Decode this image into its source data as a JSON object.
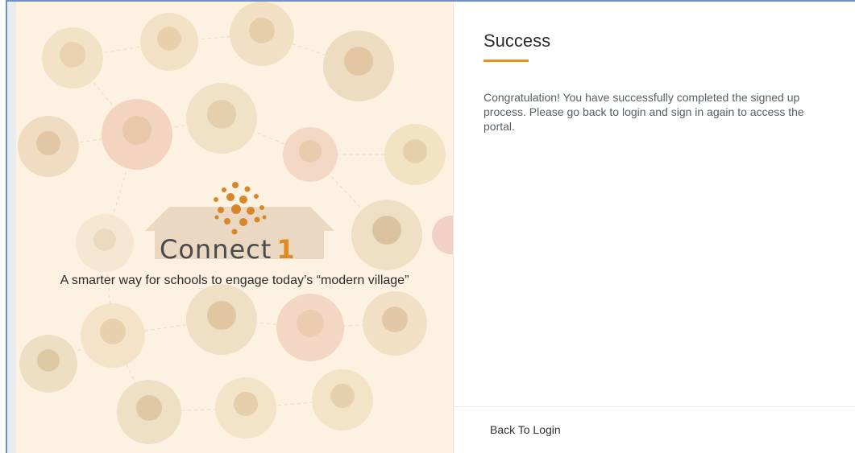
{
  "hero": {
    "brand_name": "Connect",
    "brand_number": "1",
    "tagline": "A smarter way for schools to engage today’s “modern village”"
  },
  "panel": {
    "title": "Success",
    "message": "Congratulation! You have successfully completed the signed up process. Please go back to login and sign in again to access the portal.",
    "back_label": "Back To Login"
  },
  "colors": {
    "accent": "#e8921f",
    "hero_bg": "#fdf1e2",
    "frame": "#6f8fc7"
  }
}
